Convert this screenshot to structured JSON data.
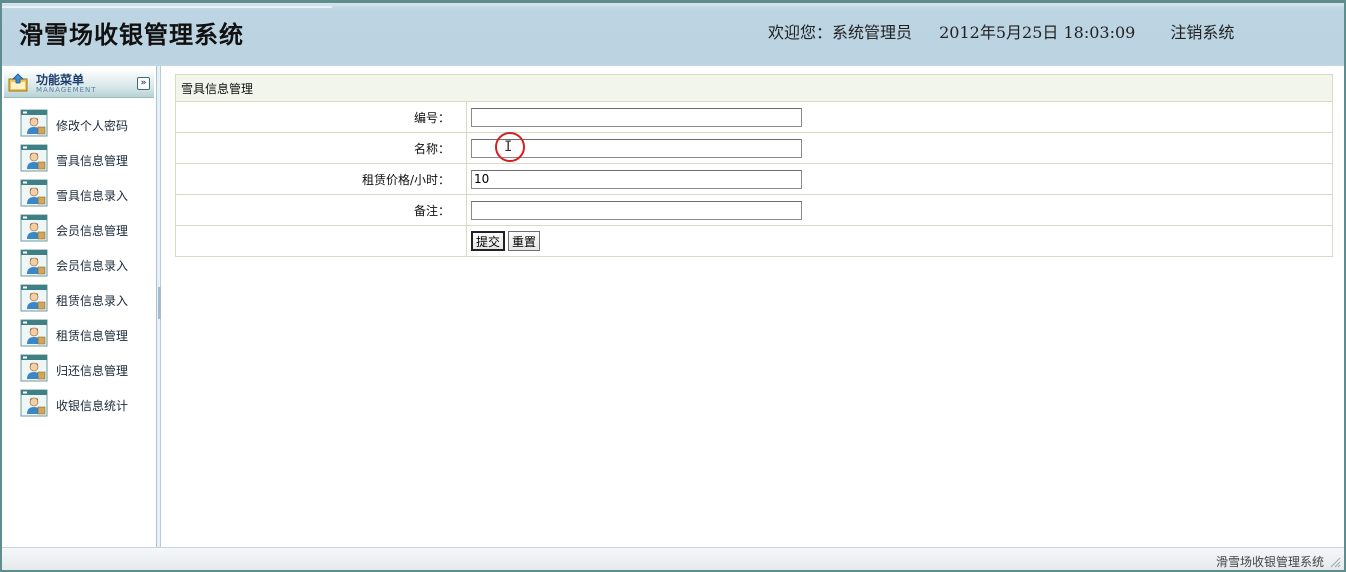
{
  "header": {
    "app_title": "滑雪场收银管理系统",
    "welcome": "欢迎您：系统管理员",
    "datetime": "2012年5月25日  18:03:09",
    "logout": "注销系统"
  },
  "sidebar": {
    "menu_title": "功能菜单",
    "menu_subtitle": "MANAGEMENT",
    "toggle_icon": "chevron-double-down-icon",
    "items": [
      {
        "label": "修改个人密码",
        "icon": "user-window-icon"
      },
      {
        "label": "雪具信息管理",
        "icon": "user-window-icon"
      },
      {
        "label": "雪具信息录入",
        "icon": "user-window-icon"
      },
      {
        "label": "会员信息管理",
        "icon": "user-window-icon"
      },
      {
        "label": "会员信息录入",
        "icon": "user-window-icon"
      },
      {
        "label": "租赁信息录入",
        "icon": "user-window-icon"
      },
      {
        "label": "租赁信息管理",
        "icon": "user-window-icon"
      },
      {
        "label": "归还信息管理",
        "icon": "user-window-icon"
      },
      {
        "label": "收银信息统计",
        "icon": "user-window-icon"
      }
    ]
  },
  "form": {
    "section_title": "雪具信息管理",
    "fields": [
      {
        "label": "编号：",
        "value": "",
        "placeholder": ""
      },
      {
        "label": "名称：",
        "value": "",
        "placeholder": ""
      },
      {
        "label": "租赁价格/小时：",
        "value": "10",
        "placeholder": ""
      },
      {
        "label": "备注：",
        "value": "",
        "placeholder": ""
      }
    ],
    "submit_label": "提交",
    "reset_label": "重置"
  },
  "statusbar": {
    "text": "滑雪场收银管理系统"
  },
  "colors": {
    "header_bg": "#bcd3e1",
    "frame_border": "#5f8c8c",
    "table_border": "#d7dcc0",
    "cursor_ring": "#d62020"
  }
}
